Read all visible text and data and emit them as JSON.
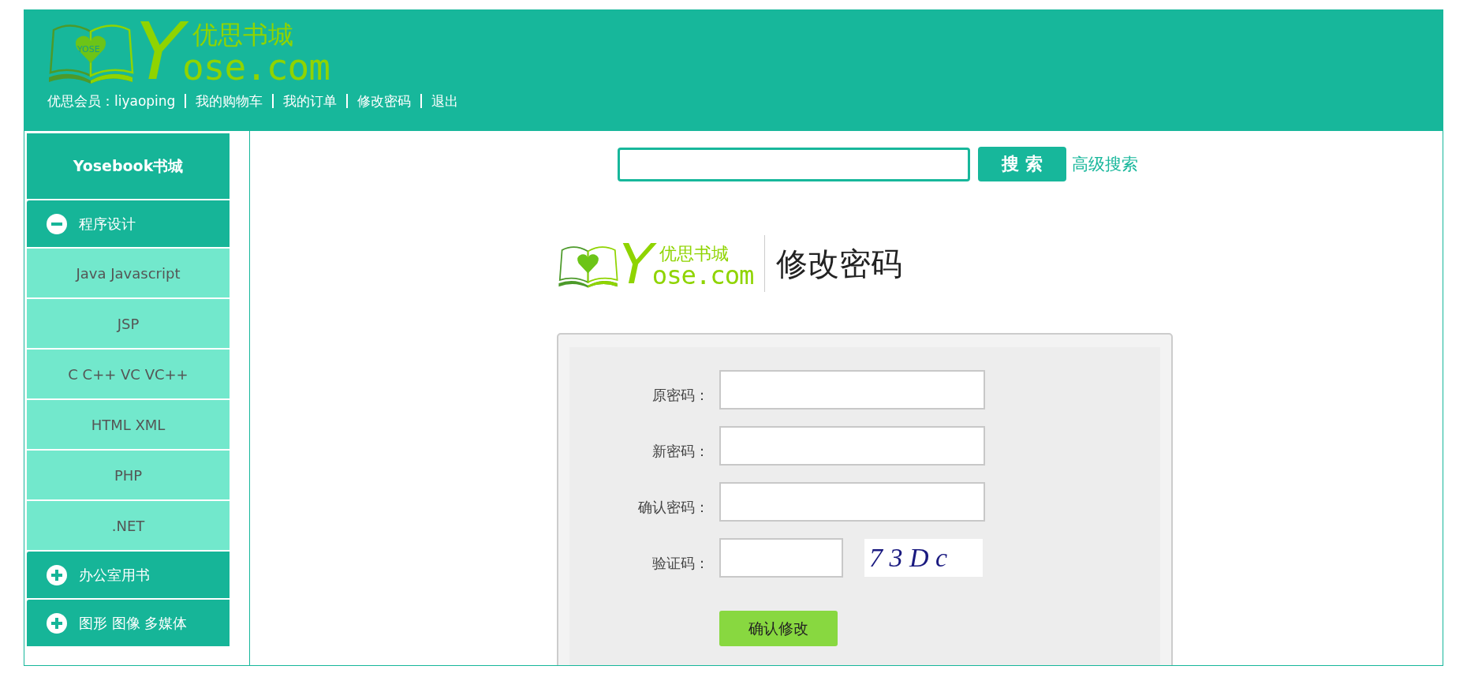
{
  "header": {
    "logo": {
      "badge": "YOSE",
      "mark": "Y",
      "wordmark": "ose.com",
      "tagline": "优思书城"
    },
    "nav": [
      {
        "label": "优思会员：liyaoping"
      },
      {
        "label": "我的购物车"
      },
      {
        "label": "我的订单"
      },
      {
        "label": "修改密码"
      },
      {
        "label": "退出"
      }
    ]
  },
  "sidebar": {
    "title": "Yosebook书城",
    "categories": [
      {
        "label": "程序设计",
        "expanded": true,
        "children": [
          {
            "label": "Java Javascript"
          },
          {
            "label": "JSP"
          },
          {
            "label": "C C++ VC VC++"
          },
          {
            "label": "HTML XML"
          },
          {
            "label": "PHP"
          },
          {
            "label": ".NET"
          }
        ]
      },
      {
        "label": "办公室用书",
        "expanded": false
      },
      {
        "label": "图形 图像 多媒体",
        "expanded": false
      }
    ]
  },
  "search": {
    "button": "搜 索",
    "advanced_link": "高级搜索"
  },
  "page_logo": {
    "mark": "Y",
    "wordmark": "ose.com",
    "tagline": "优思书城",
    "title": "修改密码"
  },
  "form": {
    "fields": [
      {
        "kind": "text",
        "label": "原密码："
      },
      {
        "kind": "text",
        "label": "新密码："
      },
      {
        "kind": "text",
        "label": "确认密码："
      },
      {
        "kind": "captcha",
        "label": "验证码：",
        "captcha": "7 3 D c"
      }
    ],
    "submit": "确认修改"
  }
}
